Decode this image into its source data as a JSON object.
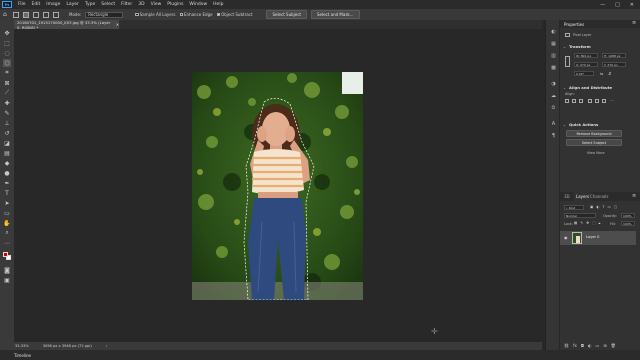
{
  "app": {
    "logo": "Ps",
    "accent": "#31a8ff"
  },
  "menu": [
    "File",
    "Edit",
    "Image",
    "Layer",
    "Type",
    "Select",
    "Filter",
    "3D",
    "View",
    "Plugins",
    "Window",
    "Help"
  ],
  "window_controls": [
    "—",
    "□",
    "✕"
  ],
  "options_bar": {
    "mode_label": "Mode:",
    "mode_value": "Rectangle",
    "sample_all_layers": "Sample All Layers",
    "enhance_edge": "Enhance Edge",
    "object_subtract": "Object Subtract",
    "select_subject": "Select Subject",
    "select_and_mask": "Select and Mask..."
  },
  "document_tab": "20180701_1915170000_K03.jpg @ 33.3% (Layer 0, RGB/8) *",
  "status": {
    "zoom": "33.33%",
    "doc_size": "3096 px x 3948 px (72 ppi)"
  },
  "bottom_panel": "Timeline",
  "tools": [
    "move-icon",
    "marquee-icon",
    "lasso-icon",
    "quick-select-icon",
    "crop-icon",
    "frame-icon",
    "eyedropper-icon",
    "healing-icon",
    "brush-icon",
    "stamp-icon",
    "history-brush-icon",
    "eraser-icon",
    "gradient-icon",
    "blur-icon",
    "dodge-icon",
    "pen-icon",
    "type-icon",
    "path-select-icon",
    "rectangle-icon",
    "hand-icon",
    "zoom-icon",
    "more-icon"
  ],
  "colors": {
    "foreground": "#d40000",
    "background": "#ffffff"
  },
  "properties": {
    "tab": "Properties",
    "layer_type": "Pixel Layer",
    "transform_title": "Transform",
    "w": "W: 891 px",
    "h": "H: 1088 px",
    "x": "X: 270 px",
    "y": "Y: 270 px",
    "angle": "0.00°",
    "align_title": "Align and Distribute",
    "align_label": "Align:",
    "quick_actions_title": "Quick Actions",
    "remove_background": "Remove Background",
    "select_subject": "Select Subject",
    "view_more": "View More"
  },
  "layers_panel": {
    "tabs": [
      "3D",
      "Layers",
      "Channels"
    ],
    "kind": "Kind",
    "blend_mode": "Normal",
    "opacity_label": "Opacity:",
    "opacity_value": "100%",
    "lock_label": "Lock:",
    "fill_label": "Fill:",
    "fill_value": "100%",
    "layers": [
      {
        "name": "Layer 0",
        "visible": true
      }
    ]
  }
}
